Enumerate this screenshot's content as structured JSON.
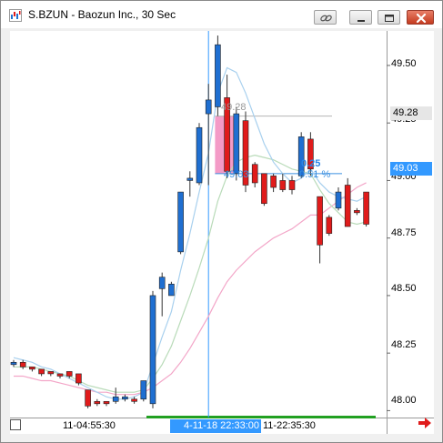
{
  "window": {
    "title": "S.BZUN - Baozun Inc., 30 Sec",
    "icons": [
      "chart-app-icon",
      "link-icon",
      "minimize-icon",
      "maximize-icon",
      "close-icon"
    ]
  },
  "colors": {
    "up_candle": "#1f6fd1",
    "down_candle": "#e01b1b",
    "ma_fast": "#a8d0ee",
    "ma_mid": "#b9dbb9",
    "ma_slow": "#f3a6c8",
    "crosshair": "#3399ff",
    "selection_box": "#f07ab4"
  },
  "price_axis": {
    "ticks": [
      "49.50",
      "49.25",
      "49.00",
      "48.75",
      "48.50",
      "48.25",
      "48.00"
    ],
    "marker_high": "49.28",
    "marker_current": "49.03"
  },
  "time_axis": {
    "labels": [
      "11-04:55:30",
      "11-22:35:30"
    ],
    "crosshair_time": "4-11-18 22:33:00"
  },
  "annotations": {
    "range_top": "49.28",
    "range_bottom": "49.03",
    "delta": "0.25",
    "delta_pct": "0.51 %"
  },
  "chart_data": {
    "type": "candlestick",
    "ylim": [
      47.97,
      49.65
    ],
    "candles": [
      {
        "o": 48.2,
        "h": 48.22,
        "l": 48.19,
        "c": 48.21
      },
      {
        "o": 48.21,
        "h": 48.22,
        "l": 48.18,
        "c": 48.19
      },
      {
        "o": 48.19,
        "h": 48.19,
        "l": 48.17,
        "c": 48.18
      },
      {
        "o": 48.18,
        "h": 48.18,
        "l": 48.15,
        "c": 48.16
      },
      {
        "o": 48.17,
        "h": 48.17,
        "l": 48.15,
        "c": 48.16
      },
      {
        "o": 48.16,
        "h": 48.16,
        "l": 48.14,
        "c": 48.15
      },
      {
        "o": 48.17,
        "h": 48.17,
        "l": 48.14,
        "c": 48.15
      },
      {
        "o": 48.16,
        "h": 48.16,
        "l": 48.11,
        "c": 48.12
      },
      {
        "o": 48.09,
        "h": 48.09,
        "l": 48.01,
        "c": 48.02
      },
      {
        "o": 48.04,
        "h": 48.05,
        "l": 48.02,
        "c": 48.03
      },
      {
        "o": 48.04,
        "h": 48.04,
        "l": 48.02,
        "c": 48.03
      },
      {
        "o": 48.04,
        "h": 48.1,
        "l": 48.03,
        "c": 48.06
      },
      {
        "o": 48.05,
        "h": 48.07,
        "l": 48.04,
        "c": 48.06
      },
      {
        "o": 48.05,
        "h": 48.06,
        "l": 48.03,
        "c": 48.04
      },
      {
        "o": 48.05,
        "h": 48.13,
        "l": 48.04,
        "c": 48.13
      },
      {
        "o": 48.03,
        "h": 48.52,
        "l": 48.01,
        "c": 48.5
      },
      {
        "o": 48.53,
        "h": 48.6,
        "l": 48.41,
        "c": 48.58
      },
      {
        "o": 48.5,
        "h": 48.56,
        "l": 48.5,
        "c": 48.55
      },
      {
        "o": 48.69,
        "h": 48.95,
        "l": 48.68,
        "c": 48.95
      },
      {
        "o": 49.0,
        "h": 49.04,
        "l": 48.93,
        "c": 49.01
      },
      {
        "o": 48.99,
        "h": 49.25,
        "l": 48.98,
        "c": 49.23
      },
      {
        "o": 49.29,
        "h": 49.42,
        "l": 48.98,
        "c": 49.35
      },
      {
        "o": 49.32,
        "h": 49.63,
        "l": 49.28,
        "c": 49.59
      },
      {
        "o": 49.36,
        "h": 49.46,
        "l": 49.01,
        "c": 49.04
      },
      {
        "o": 49.03,
        "h": 49.32,
        "l": 49.0,
        "c": 49.29
      },
      {
        "o": 49.26,
        "h": 49.3,
        "l": 48.95,
        "c": 48.98
      },
      {
        "o": 49.07,
        "h": 49.08,
        "l": 48.97,
        "c": 48.99
      },
      {
        "o": 49.03,
        "h": 49.03,
        "l": 48.89,
        "c": 48.9
      },
      {
        "o": 49.02,
        "h": 49.03,
        "l": 48.95,
        "c": 48.97
      },
      {
        "o": 49.0,
        "h": 49.03,
        "l": 48.95,
        "c": 48.96
      },
      {
        "o": 49.0,
        "h": 49.02,
        "l": 48.94,
        "c": 48.96
      },
      {
        "o": 49.02,
        "h": 49.21,
        "l": 49.01,
        "c": 49.19
      },
      {
        "o": 49.18,
        "h": 49.21,
        "l": 49.02,
        "c": 49.05
      },
      {
        "o": 48.93,
        "h": 48.93,
        "l": 48.64,
        "c": 48.72
      },
      {
        "o": 48.84,
        "h": 48.85,
        "l": 48.76,
        "c": 48.77
      },
      {
        "o": 48.88,
        "h": 48.97,
        "l": 48.87,
        "c": 48.95
      },
      {
        "o": 48.98,
        "h": 49.01,
        "l": 48.8,
        "c": 48.8
      },
      {
        "o": 48.87,
        "h": 48.88,
        "l": 48.85,
        "c": 48.86
      },
      {
        "o": 48.95,
        "h": 48.95,
        "l": 48.8,
        "c": 48.81
      }
    ],
    "ma_fast": [
      48.23,
      48.22,
      48.21,
      48.19,
      48.18,
      48.16,
      48.14,
      48.12,
      48.1,
      48.08,
      48.06,
      48.05,
      48.05,
      48.06,
      48.08,
      48.2,
      48.32,
      48.43,
      48.61,
      48.77,
      48.95,
      49.12,
      49.38,
      49.49,
      49.47,
      49.38,
      49.27,
      49.16,
      49.08,
      49.03,
      48.99,
      49.01,
      49.05,
      48.99,
      48.95,
      48.93,
      48.92,
      48.91,
      48.93
    ],
    "ma_mid": [
      48.19,
      48.19,
      48.19,
      48.18,
      48.17,
      48.16,
      48.15,
      48.13,
      48.11,
      48.1,
      48.09,
      48.08,
      48.08,
      48.08,
      48.09,
      48.14,
      48.2,
      48.28,
      48.39,
      48.5,
      48.62,
      48.75,
      48.91,
      49.02,
      49.08,
      49.1,
      49.11,
      49.1,
      49.09,
      49.07,
      49.05,
      49.04,
      49.03,
      48.96,
      48.9,
      48.86,
      48.82,
      48.81,
      48.82
    ],
    "ma_slow": [
      48.15,
      48.15,
      48.14,
      48.13,
      48.13,
      48.12,
      48.11,
      48.1,
      48.09,
      48.08,
      48.08,
      48.07,
      48.07,
      48.07,
      48.08,
      48.1,
      48.13,
      48.16,
      48.21,
      48.27,
      48.34,
      48.41,
      48.49,
      48.56,
      48.61,
      48.65,
      48.69,
      48.72,
      48.75,
      48.77,
      48.79,
      48.82,
      48.85,
      48.85,
      48.88,
      48.91,
      48.94,
      48.97,
      48.99
    ],
    "selection": {
      "from_index": 22,
      "to_index": 24,
      "top": 49.28,
      "bottom": 49.03
    },
    "crosshair_index": 21
  }
}
